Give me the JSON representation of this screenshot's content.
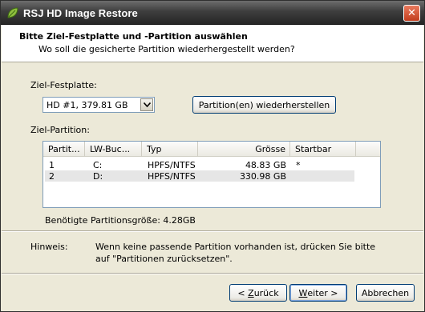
{
  "window": {
    "title": "RSJ HD Image Restore",
    "close_glyph": "✕"
  },
  "header": {
    "title": "Bitte Ziel-Festplatte und -Partition auswählen",
    "subtitle": "Wo soll die gesicherte Partition wiederhergestellt werden?"
  },
  "target_disk": {
    "label": "Ziel-Festplatte:",
    "selected": "HD #1, 379.81 GB"
  },
  "restore_button": "Partition(en) wiederherstellen",
  "partition": {
    "label": "Ziel-Partition:",
    "columns": [
      "Partit...",
      "LW-Buc...",
      "Typ",
      "Grösse",
      "Startbar"
    ],
    "rows": [
      {
        "num": "1",
        "drive": "C:",
        "type": "HPFS/NTFS",
        "size": "48.83 GB",
        "boot": "*"
      },
      {
        "num": "2",
        "drive": "D:",
        "type": "HPFS/NTFS",
        "size": "330.98 GB",
        "boot": ""
      }
    ]
  },
  "required_size": "Benötigte Partitionsgröße: 4.28GB",
  "hint": {
    "label": "Hinweis:",
    "line1": "Wenn keine passende Partition vorhanden ist, drücken Sie bitte",
    "line2": "auf \"Partitionen zurücksetzen\"."
  },
  "buttons": {
    "back_prefix": "< ",
    "back_key": "Z",
    "back_rest": "urück",
    "next_key": "W",
    "next_rest": "eiter >",
    "cancel": "Abbrechen"
  },
  "icons": {
    "app": "leaf-app-icon",
    "close": "close-icon",
    "dropdown": "chevron-down-icon"
  }
}
